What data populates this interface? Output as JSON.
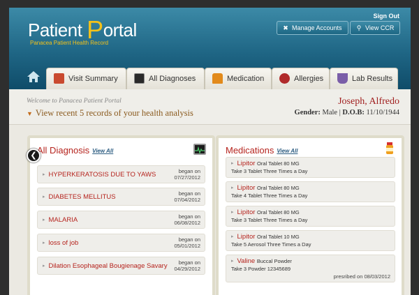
{
  "header": {
    "sign_out": "Sign Out",
    "logo_main_a": "Patient ",
    "logo_main_big": "P",
    "logo_main_b": "ortal",
    "logo_sub": "Panacea Patient Health Record",
    "manage_accounts": "Manage Accounts",
    "view_ccr": "View CCR"
  },
  "nav": {
    "tabs": [
      {
        "label": "Visit Summary",
        "icon": "calendar-icon",
        "color": "#c94a2f"
      },
      {
        "label": "All Diagnoses",
        "icon": "ecg-monitor-icon",
        "color": "#2a2a2a"
      },
      {
        "label": "Medication",
        "icon": "pill-bottle-icon",
        "color": "#e28a1b"
      },
      {
        "label": "Allergies",
        "icon": "flower-icon",
        "color": "#b02a2a"
      },
      {
        "label": "Lab Results",
        "icon": "flask-icon",
        "color": "#7a5ea8"
      }
    ]
  },
  "welcome": {
    "text": "Welcome to Panacea Patient Portal",
    "records": "View recent 5 records of your health analysis"
  },
  "patient": {
    "name": "Joseph, Alfredo",
    "gender_label": "Gender:",
    "gender": "Male",
    "sep": "|",
    "dob_label": "D.O.B:",
    "dob": "11/10/1944"
  },
  "diagnosis": {
    "title": "All Diagnosis",
    "view_all": "View All",
    "began_label": "began on",
    "items": [
      {
        "name": "HYPERKERATOSIS DUE TO YAWS",
        "date": "07/27/2012"
      },
      {
        "name": "DIABETES MELLITUS",
        "date": "07/04/2012"
      },
      {
        "name": "MALARIA",
        "date": "06/08/2012"
      },
      {
        "name": "loss of job",
        "date": "05/01/2012"
      },
      {
        "name": "Dilation Esophageal Bougienage Savary",
        "date": "04/29/2012"
      }
    ]
  },
  "medications": {
    "title": "Medications",
    "view_all": "View All",
    "items": [
      {
        "name": "Lipitor",
        "form": "Oral Tablet 80 MG",
        "dose": "Take 3 Tablet Three Times a Day"
      },
      {
        "name": "Lipitor",
        "form": "Oral Tablet 80 MG",
        "dose": "Take 4 Tablet Three Times a Day"
      },
      {
        "name": "Lipitor",
        "form": "Oral Tablet 80 MG",
        "dose": "Take 3 Tablet Three Times a Day"
      },
      {
        "name": "Lipitor",
        "form": "Oral Tablet 10 MG",
        "dose": "Take 5 Aerosol Three Times a Day"
      },
      {
        "name": "Valine",
        "form": "Buccal Powder",
        "dose": "Take 3 Powder 12345689",
        "prescribed": "presribed on 08/03/2012"
      }
    ]
  },
  "colors": {
    "header": "#1f6685",
    "accent_red": "#b5231d",
    "logo_yellow": "#f4c21a"
  }
}
